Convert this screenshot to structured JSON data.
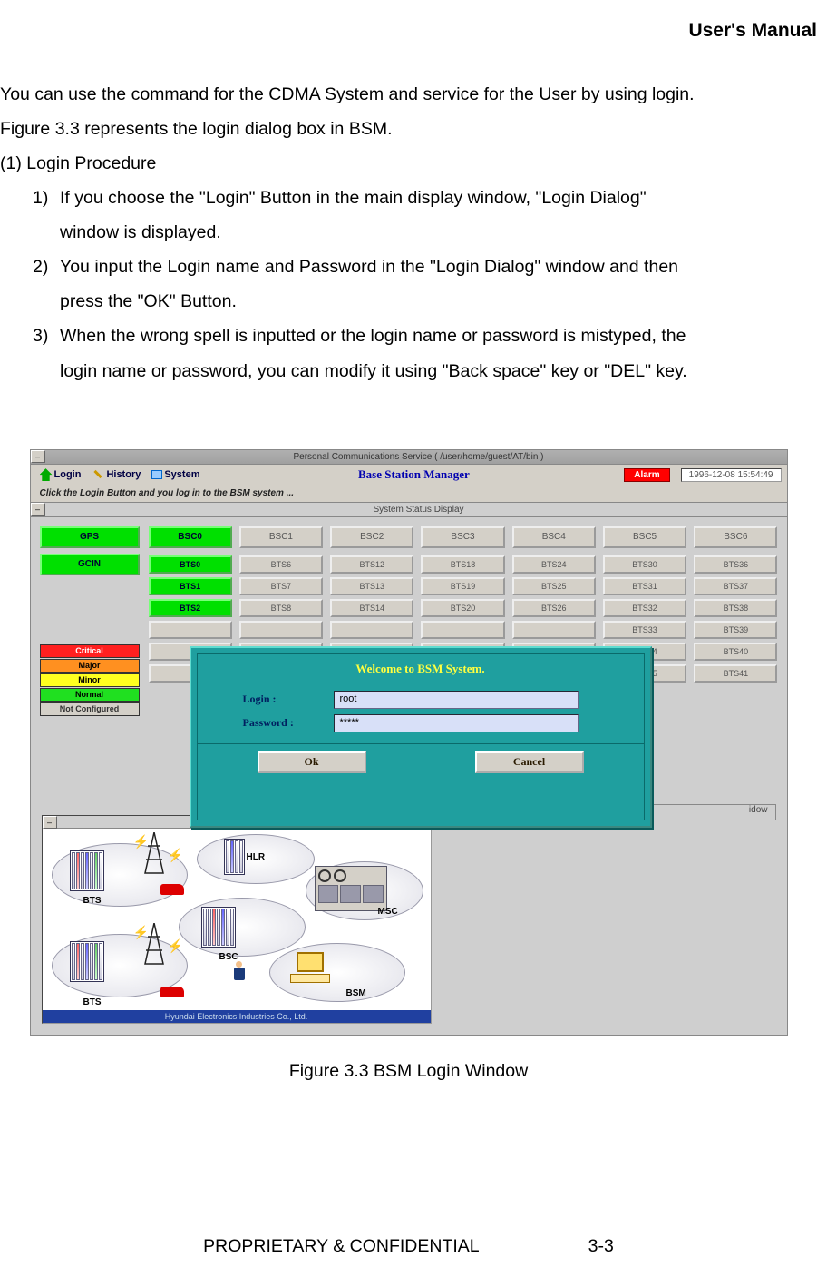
{
  "page": {
    "header": "User's Manual",
    "intro1": "You can use the command for the CDMA System and service for the User by using login.",
    "intro2": "Figure 3.3 represents the login dialog box in BSM.",
    "procedure_label": "(1)  Login Procedure",
    "steps": {
      "s1n": "1)",
      "s1a": "If you choose the \"Login\" Button in the main display window, \"Login Dialog\"",
      "s1b": "window is displayed.",
      "s2n": "2)",
      "s2a": "You input the Login name and Password in the \"Login Dialog\" window and then",
      "s2b": "press the \"OK\" Button.",
      "s3n": "3)",
      "s3a": "When the wrong spell is inputted or the login name or password is mistyped, the",
      "s3b": "login name or password, you can modify it using \"Back space\" key or \"DEL\" key."
    },
    "figure_caption": "Figure 3.3 BSM Login Window",
    "footer_left": "PROPRIETARY & CONFIDENTIAL",
    "footer_right": "3-3"
  },
  "screenshot": {
    "window_title": "Personal Communications Service ( /user/home/guest/AT/bin )",
    "toolbar": {
      "login": "Login",
      "history": "History",
      "system": "System",
      "app_title": "Base Station Manager",
      "alarm": "Alarm",
      "timestamp": "1996-12-08 15:54:49"
    },
    "hint": "Click the Login Button and you log in to the BSM system ...",
    "status_title": "System Status Display",
    "left": {
      "gps": "GPS",
      "gcin": "GCIN"
    },
    "legend": {
      "critical": "Critical",
      "major": "Major",
      "minor": "Minor",
      "normal": "Normal",
      "not_configured": "Not Configured"
    },
    "bsc": [
      "BSC0",
      "BSC1",
      "BSC2",
      "BSC3",
      "BSC4",
      "BSC5",
      "BSC6"
    ],
    "bts_cols": [
      [
        "BTS0",
        "BTS1",
        "BTS2",
        "",
        "",
        ""
      ],
      [
        "BTS6",
        "BTS7",
        "BTS8",
        "",
        "",
        ""
      ],
      [
        "BTS12",
        "BTS13",
        "BTS14",
        "",
        "",
        ""
      ],
      [
        "BTS18",
        "BTS19",
        "BTS20",
        "",
        "",
        ""
      ],
      [
        "BTS24",
        "BTS25",
        "BTS26",
        "",
        "",
        ""
      ],
      [
        "BTS30",
        "BTS31",
        "BTS32",
        "BTS33",
        "BTS34",
        "BTS35"
      ],
      [
        "BTS36",
        "BTS37",
        "BTS38",
        "BTS39",
        "BTS40",
        "BTS41"
      ]
    ],
    "msg_window_label": "idow",
    "diagram": {
      "bts1": "BTS",
      "bts2": "BTS",
      "hlr": "HLR",
      "bsc": "BSC",
      "msc": "MSC",
      "bsm": "BSM",
      "footer": "Hyundai Electronics Industries Co., Ltd."
    },
    "login_dialog": {
      "title": "Welcome to BSM System.",
      "login_label": "Login    :",
      "password_label": "Password :",
      "login_value": "root",
      "password_value": "*****",
      "ok": "Ok",
      "cancel": "Cancel"
    }
  }
}
